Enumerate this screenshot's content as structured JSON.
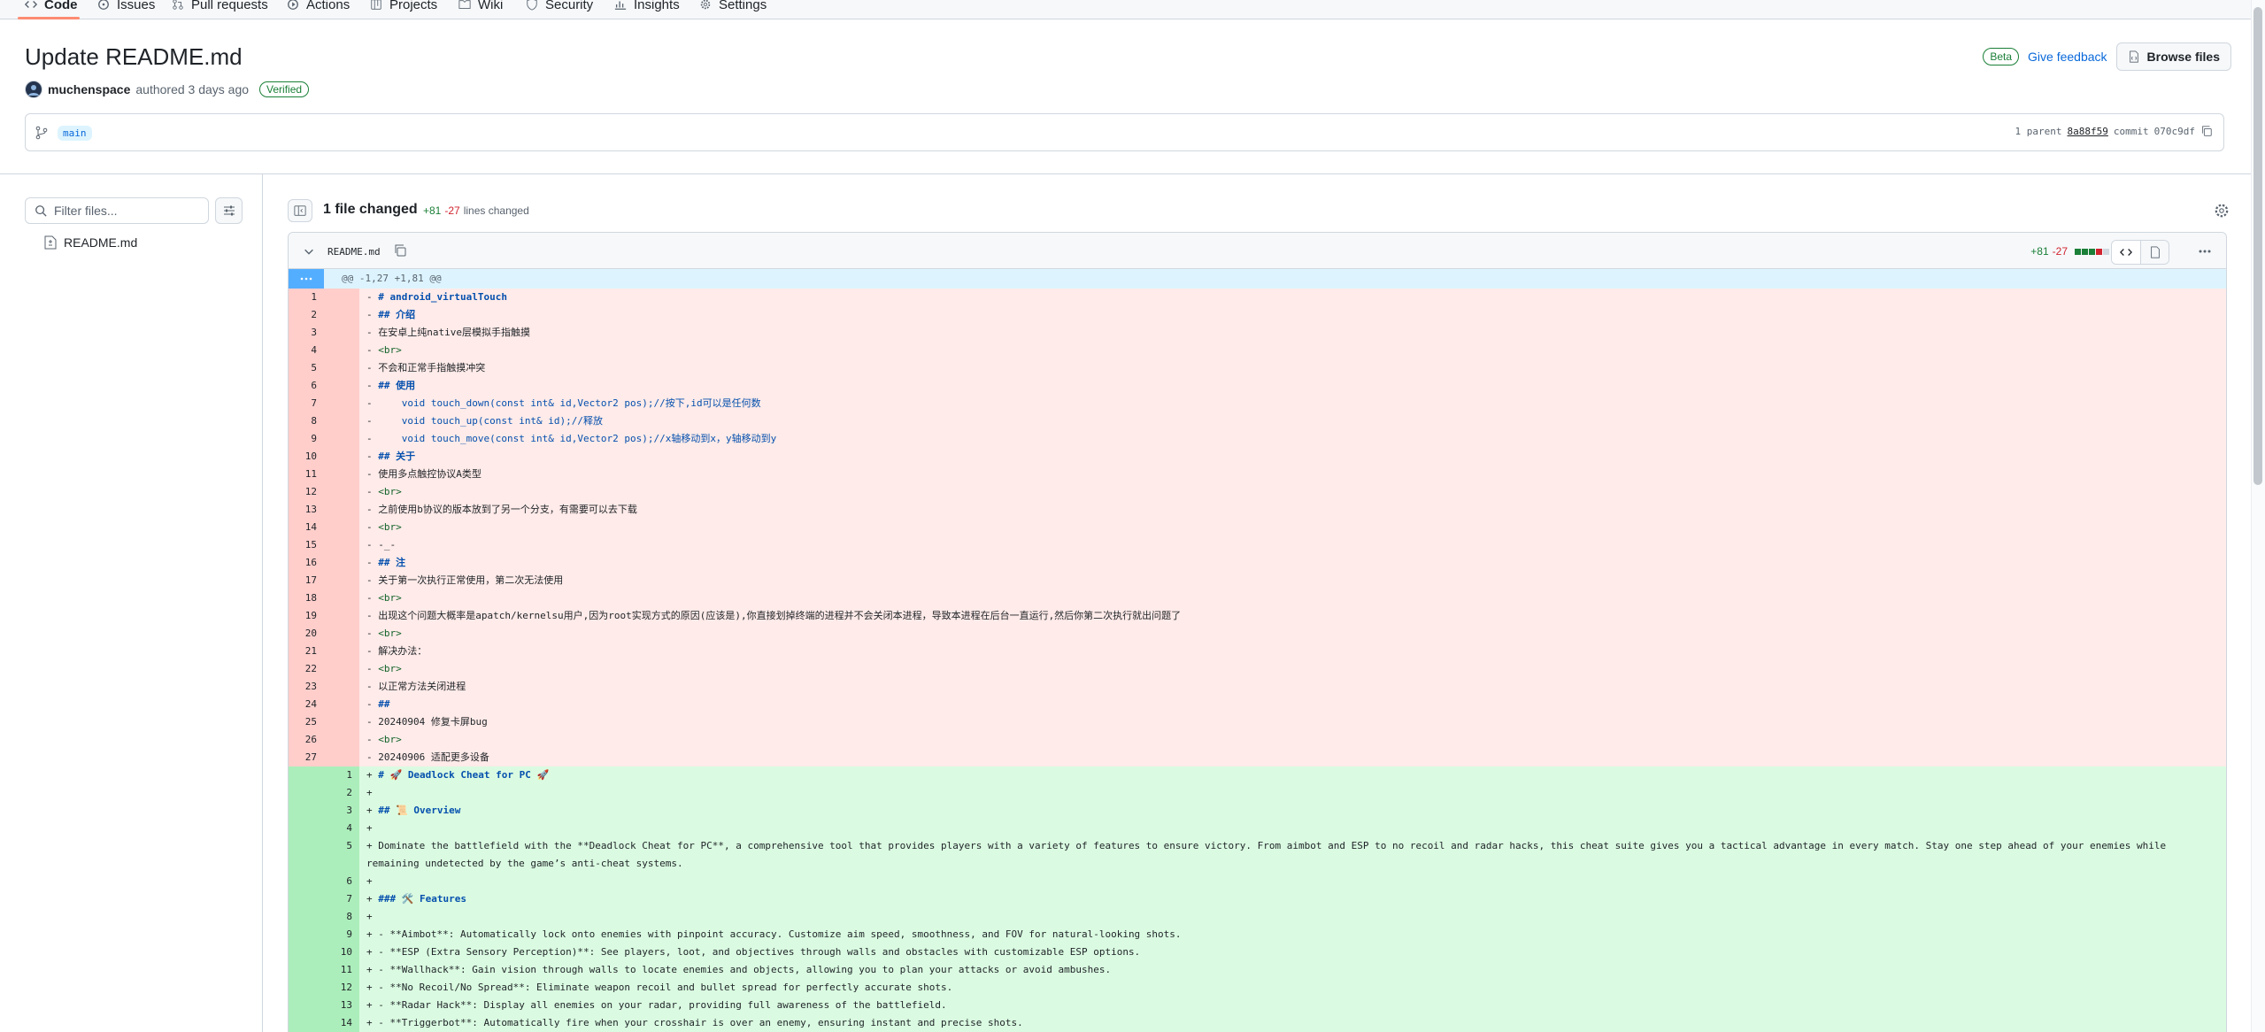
{
  "tabs": [
    {
      "label": "Code",
      "icon": "code-icon"
    },
    {
      "label": "Issues",
      "icon": "issue-icon"
    },
    {
      "label": "Pull requests",
      "icon": "pull-request-icon"
    },
    {
      "label": "Actions",
      "icon": "actions-icon"
    },
    {
      "label": "Projects",
      "icon": "projects-icon"
    },
    {
      "label": "Wiki",
      "icon": "wiki-icon"
    },
    {
      "label": "Security",
      "icon": "shield-icon"
    },
    {
      "label": "Insights",
      "icon": "graph-icon"
    },
    {
      "label": "Settings",
      "icon": "gear-icon"
    }
  ],
  "commit": {
    "title": "Update README.md",
    "author": "muchenspace",
    "authored": "authored 3 days ago",
    "verified": "Verified",
    "beta": "Beta",
    "feedback": "Give feedback",
    "browse": "Browse files",
    "branch": "main",
    "parent_label": "1 parent",
    "parent_sha": "8a88f59",
    "commit_label": "commit",
    "commit_sha": "070c9df"
  },
  "sidebar": {
    "filter_placeholder": "Filter files...",
    "files": [
      "README.md"
    ]
  },
  "summary": {
    "files_changed": "1 file changed",
    "additions": "+81",
    "deletions": "-27",
    "lines_changed": "lines changed"
  },
  "diff": {
    "filename": "README.md",
    "additions": "+81",
    "deletions": "-27",
    "hunk": "@@ -1,27 +1,81 @@",
    "deleted_lines": [
      "# android_virtualTouch",
      "## 介绍",
      "在安卓上纯native层模拟手指触摸",
      "<br>",
      "不会和正常手指触摸冲突",
      "## 使用",
      "    void touch_down(const int& id,Vector2 pos);//按下,id可以是任何数",
      "    void touch_up(const int& id);//释放",
      "    void touch_move(const int& id,Vector2 pos);//x轴移动到x，y轴移动到y",
      "## 关于",
      "使用多点触控协议A类型",
      "<br>",
      "之前使用b协议的版本放到了另一个分支，有需要可以去下载",
      "<br>",
      "-_-",
      "## 注",
      "关于第一次执行正常使用，第二次无法使用",
      "<br>",
      "出现这个问题大概率是apatch/kernelsu用户,因为root实现方式的原因(应该是),你直接划掉终端的进程并不会关闭本进程，导致本进程在后台一直运行,然后你第二次执行就出问题了",
      "<br>",
      "解决办法：",
      "<br>",
      "以正常方法关闭进程",
      "##",
      "20240904 修复卡屏bug",
      "<br>",
      "20240906 适配更多设备"
    ],
    "added_lines": [
      {
        "n": "1",
        "text": "# 🚀 Deadlock Cheat for PC 🚀"
      },
      {
        "n": "2",
        "text": ""
      },
      {
        "n": "3",
        "text": "## 📜 Overview"
      },
      {
        "n": "4",
        "text": ""
      },
      {
        "n": "5",
        "text": "Dominate the battlefield with the **Deadlock Cheat for PC**, a comprehensive tool that provides players with a variety of features to ensure victory. From aimbot and ESP to no recoil and radar hacks, this cheat suite gives you a tactical advantage in every match. Stay one step ahead of your enemies while remaining undetected by the game’s anti-cheat systems."
      },
      {
        "n": "6",
        "text": ""
      },
      {
        "n": "7",
        "text": "### 🛠️ Features"
      },
      {
        "n": "8",
        "text": ""
      },
      {
        "n": "9",
        "text": "- **Aimbot**: Automatically lock onto enemies with pinpoint accuracy. Customize aim speed, smoothness, and FOV for natural-looking shots."
      },
      {
        "n": "10",
        "text": "- **ESP (Extra Sensory Perception)**: See players, loot, and objectives through walls and obstacles with customizable ESP options."
      },
      {
        "n": "11",
        "text": "- **Wallhack**: Gain vision through walls to locate enemies and objects, allowing you to plan your attacks or avoid ambushes."
      },
      {
        "n": "12",
        "text": "- **No Recoil/No Spread**: Eliminate weapon recoil and bullet spread for perfectly accurate shots."
      },
      {
        "n": "13",
        "text": "- **Radar Hack**: Display all enemies on your radar, providing full awareness of the battlefield."
      },
      {
        "n": "14",
        "text": "- **Triggerbot**: Automatically fire when your crosshair is over an enemy, ensuring instant and precise shots."
      }
    ]
  },
  "colors": {
    "accent": "#0969da",
    "added_bg": "#dafbe1",
    "deleted_bg": "#ffebe9",
    "hunk_bg": "#ddf4ff",
    "tab_underline": "#fd8c73"
  }
}
